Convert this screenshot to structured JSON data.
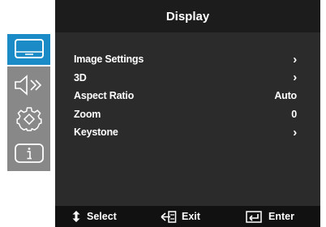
{
  "header": {
    "title": "Display"
  },
  "sidebar": {
    "tabs": [
      {
        "icon": "display-icon",
        "active": true
      },
      {
        "icon": "speaker-icon",
        "active": false
      },
      {
        "icon": "gear-icon",
        "active": false
      },
      {
        "icon": "info-icon",
        "active": false
      }
    ]
  },
  "menu": {
    "items": [
      {
        "label": "Image Settings",
        "value": "›",
        "kind": "submenu"
      },
      {
        "label": "3D",
        "value": "›",
        "kind": "submenu"
      },
      {
        "label": "Aspect Ratio",
        "value": "Auto",
        "kind": "value"
      },
      {
        "label": "Zoom",
        "value": "0",
        "kind": "value"
      },
      {
        "label": "Keystone",
        "value": "›",
        "kind": "submenu"
      }
    ]
  },
  "footer": {
    "select_label": "Select",
    "exit_label": "Exit",
    "enter_label": "Enter"
  },
  "colors": {
    "accent": "#1a8bc6",
    "panel": "#2b2b2b",
    "title_bar": "#1c1c1c",
    "sidebar": "#888888",
    "footer": "#111111"
  }
}
